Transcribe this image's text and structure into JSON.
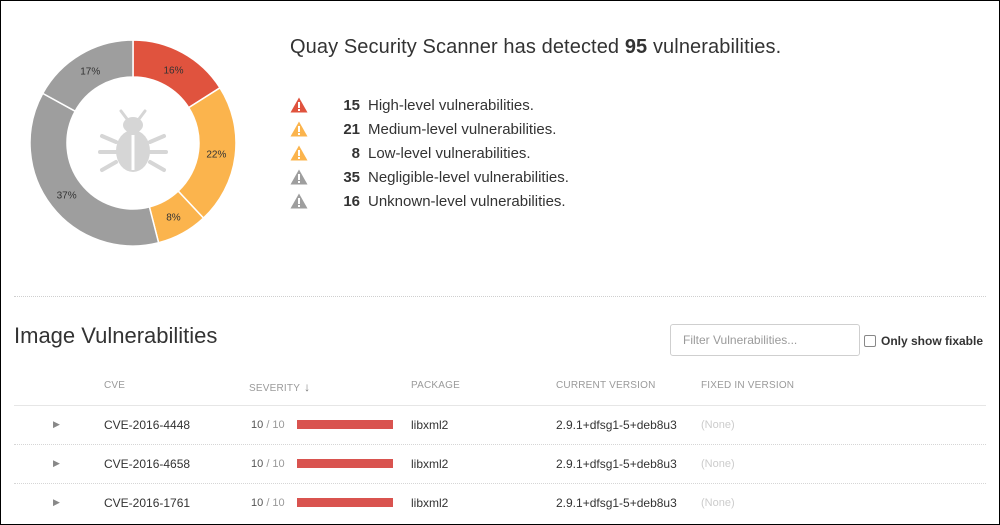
{
  "summary": {
    "prefix": "Quay Security Scanner has detected",
    "total": "95",
    "suffix": "vulnerabilities."
  },
  "donut": {
    "icon": "bug-icon",
    "slices": [
      {
        "name": "High",
        "percent": 16,
        "label": "16%",
        "color": "#e0533e"
      },
      {
        "name": "Medium",
        "percent": 22,
        "label": "22%",
        "color": "#fbb44d"
      },
      {
        "name": "Low",
        "percent": 8,
        "label": "8%",
        "color": "#fbb44d"
      },
      {
        "name": "Negligible",
        "percent": 37,
        "label": "37%",
        "color": "#9e9e9e"
      },
      {
        "name": "Unknown",
        "percent": 17,
        "label": "17%",
        "color": "#9e9e9e"
      }
    ]
  },
  "levels": [
    {
      "count": "15",
      "label": "High-level vulnerabilities.",
      "color": "#e0533e",
      "icon": "warning-icon"
    },
    {
      "count": "21",
      "label": "Medium-level vulnerabilities.",
      "color": "#fbb44d",
      "icon": "warning-icon"
    },
    {
      "count": "8",
      "label": "Low-level vulnerabilities.",
      "color": "#fbb44d",
      "icon": "warning-icon"
    },
    {
      "count": "35",
      "label": "Negligible-level vulnerabilities.",
      "color": "#9e9e9e",
      "icon": "warning-icon"
    },
    {
      "count": "16",
      "label": "Unknown-level vulnerabilities.",
      "color": "#9e9e9e",
      "icon": "warning-icon"
    }
  ],
  "section": {
    "title": "Image Vulnerabilities",
    "filter_placeholder": "Filter Vulnerabilities...",
    "fixable_label": "Only show fixable"
  },
  "table": {
    "columns": {
      "cve": "CVE",
      "severity": "SEVERITY",
      "package": "PACKAGE",
      "current": "CURRENT VERSION",
      "fixed": "FIXED IN VERSION"
    },
    "sort_icon": "sort-down-arrow-icon",
    "rows": [
      {
        "cve": "CVE-2016-4448",
        "score": "10",
        "max": "/ 10",
        "severity_fraction": 1.0,
        "package": "libxml2",
        "current": "2.9.1+dfsg1-5+deb8u3",
        "fixed": "(None)"
      },
      {
        "cve": "CVE-2016-4658",
        "score": "10",
        "max": "/ 10",
        "severity_fraction": 1.0,
        "package": "libxml2",
        "current": "2.9.1+dfsg1-5+deb8u3",
        "fixed": "(None)"
      },
      {
        "cve": "CVE-2016-1761",
        "score": "10",
        "max": "/ 10",
        "severity_fraction": 1.0,
        "package": "libxml2",
        "current": "2.9.1+dfsg1-5+deb8u3",
        "fixed": "(None)"
      }
    ]
  }
}
